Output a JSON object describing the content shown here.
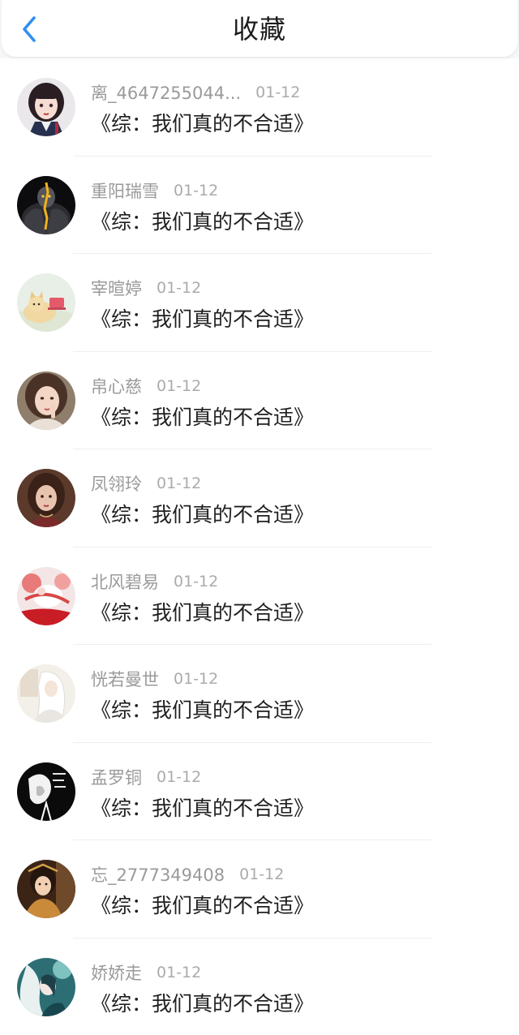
{
  "header": {
    "title": "收藏"
  },
  "favorites": [
    {
      "name": "离_4647255044...",
      "date": "01-12",
      "book": "《综：我们真的不合适》",
      "avatar": "anime-girl-avatar"
    },
    {
      "name": "重阳瑞雪",
      "date": "01-12",
      "book": "《综：我们真的不合适》",
      "avatar": "dark-warrior-avatar"
    },
    {
      "name": "宰暄婷",
      "date": "01-12",
      "book": "《综：我们真的不合适》",
      "avatar": "cat-avatar"
    },
    {
      "name": "帛心慈",
      "date": "01-12",
      "book": "《综：我们真的不合适》",
      "avatar": "girl-photo-avatar"
    },
    {
      "name": "凤翎玲",
      "date": "01-12",
      "book": "《综：我们真的不合适》",
      "avatar": "portrait-avatar"
    },
    {
      "name": "北风碧易",
      "date": "01-12",
      "book": "《综：我们真的不合适》",
      "avatar": "red-white-art-avatar"
    },
    {
      "name": "恍若曼世",
      "date": "01-12",
      "book": "《综：我们真的不合适》",
      "avatar": "white-hair-avatar"
    },
    {
      "name": "孟罗铜",
      "date": "01-12",
      "book": "《综：我们真的不合适》",
      "avatar": "black-white-art-avatar"
    },
    {
      "name": "忘_2777349408",
      "date": "01-12",
      "book": "《综：我们真的不合适》",
      "avatar": "ancient-costume-avatar"
    },
    {
      "name": "娇娇走",
      "date": "01-12",
      "book": "《综：我们真的不合适》",
      "avatar": "teal-art-avatar"
    }
  ],
  "colors": {
    "accent": "#2f8ff1",
    "title": "#1b1b1b",
    "meta": "#9a9a9a",
    "book": "#1f1f1f"
  }
}
